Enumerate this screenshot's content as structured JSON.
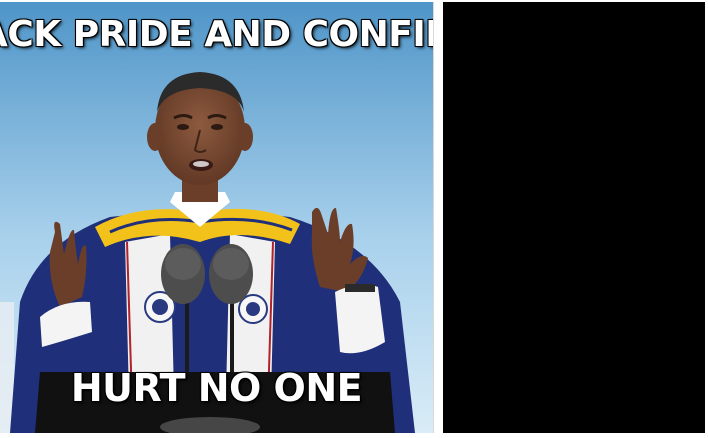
{
  "left_panel": {
    "top_caption": "ACK PRIDE AND CONFIDEN",
    "bottom_caption": "HURT NO ONE",
    "colors": {
      "sky_top": "#5a9fd0",
      "sky_bottom": "#cfe6f5",
      "robe_blue": "#1f2f7a",
      "robe_white": "#f1f1f1",
      "hood_gold": "#f2c21a",
      "skin": "#7a4a32"
    }
  },
  "right_panel": {
    "color": "#000000"
  }
}
